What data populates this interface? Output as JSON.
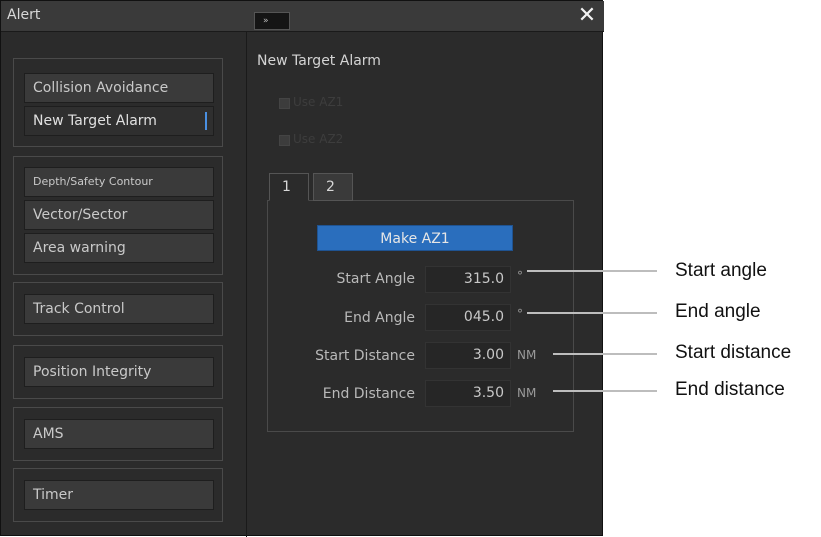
{
  "window": {
    "title": "Alert",
    "collapse_label": "»",
    "close_label": "✕"
  },
  "sidebar": {
    "groups": [
      {
        "items": [
          {
            "label": "Collision Avoidance"
          },
          {
            "label": "New Target Alarm",
            "selected": true
          }
        ]
      },
      {
        "items": [
          {
            "label": "Depth/Safety Contour"
          },
          {
            "label": "Vector/Sector"
          },
          {
            "label": "Area warning"
          }
        ]
      },
      {
        "items": [
          {
            "label": "Track Control"
          }
        ]
      },
      {
        "items": [
          {
            "label": "Position Integrity"
          }
        ]
      },
      {
        "items": [
          {
            "label": "AMS"
          }
        ]
      },
      {
        "items": [
          {
            "label": "Timer"
          }
        ]
      }
    ]
  },
  "panel": {
    "title": "New Target Alarm",
    "checkboxes": [
      {
        "label": "Use AZ1",
        "checked": false,
        "enabled": false
      },
      {
        "label": "Use AZ2",
        "checked": false,
        "enabled": false
      }
    ],
    "tabs": [
      {
        "label": "1",
        "active": true
      },
      {
        "label": "2",
        "active": false
      }
    ],
    "make_button": "Make AZ1",
    "fields": {
      "start_angle": {
        "label": "Start Angle",
        "value": "315.0",
        "unit": "°"
      },
      "end_angle": {
        "label": "End Angle",
        "value": "045.0",
        "unit": "°"
      },
      "start_distance": {
        "label": "Start Distance",
        "value": "3.00",
        "unit": "NM"
      },
      "end_distance": {
        "label": "End Distance",
        "value": "3.50",
        "unit": "NM"
      }
    }
  },
  "callouts": {
    "start_angle": "Start angle",
    "end_angle": "End angle",
    "start_distance": "Start distance",
    "end_distance": "End distance"
  },
  "colors": {
    "window_bg": "#2b2b2b",
    "accent_blue": "#2a6ebd",
    "selection_marker": "#4a90e2"
  }
}
